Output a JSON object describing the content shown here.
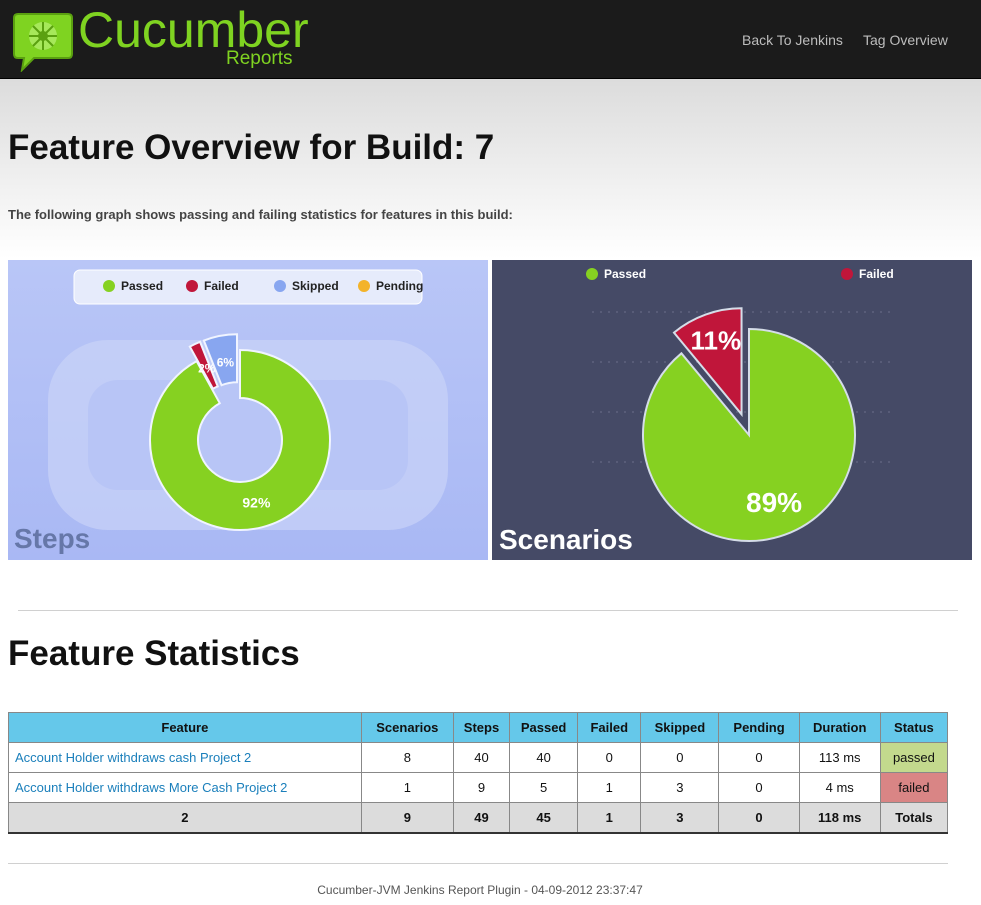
{
  "header": {
    "logo_title": "Cucumber",
    "logo_subtitle": "Reports",
    "nav": {
      "back_to_jenkins": "Back To Jenkins",
      "tag_overview": "Tag Overview"
    },
    "brand_color": "#7fd321"
  },
  "page": {
    "title": "Feature Overview for Build: 7",
    "intro": "The following graph shows passing and failing statistics for features in this build:",
    "stats_title": "Feature Statistics",
    "footer": "Cucumber-JVM Jenkins Report Plugin - 04-09-2012 23:37:47"
  },
  "chart_data": [
    {
      "type": "pie",
      "title": "Steps",
      "legend": [
        "Passed",
        "Failed",
        "Skipped",
        "Pending"
      ],
      "legend_placement": "top",
      "slices": [
        {
          "name": "Passed",
          "value": 92,
          "label": "92%",
          "color": "#86d121"
        },
        {
          "name": "Failed",
          "value": 2,
          "label": "2%",
          "color": "#c0163a"
        },
        {
          "name": "Skipped",
          "value": 6,
          "label": "6%",
          "color": "#88a6f0"
        },
        {
          "name": "Pending",
          "value": 0,
          "label": "",
          "color": "#f3b32a"
        }
      ]
    },
    {
      "type": "pie",
      "title": "Scenarios",
      "legend": [
        "Passed",
        "Failed"
      ],
      "legend_placement": "top",
      "slices": [
        {
          "name": "Passed",
          "value": 89,
          "label": "89%",
          "color": "#86d121"
        },
        {
          "name": "Failed",
          "value": 11,
          "label": "11%",
          "color": "#c0163a"
        }
      ]
    }
  ],
  "table": {
    "headers": [
      "Feature",
      "Scenarios",
      "Steps",
      "Passed",
      "Failed",
      "Skipped",
      "Pending",
      "Duration",
      "Status"
    ],
    "rows": [
      {
        "feature": "Account Holder withdraws cash Project 2",
        "scenarios": "8",
        "steps": "40",
        "passed": "40",
        "failed": "0",
        "skipped": "0",
        "pending": "0",
        "duration": "113 ms",
        "status": "passed"
      },
      {
        "feature": "Account Holder withdraws More Cash Project 2",
        "scenarios": "1",
        "steps": "9",
        "passed": "5",
        "failed": "1",
        "skipped": "3",
        "pending": "0",
        "duration": "4 ms",
        "status": "failed"
      }
    ],
    "totals": {
      "feature": "2",
      "scenarios": "9",
      "steps": "49",
      "passed": "45",
      "failed": "1",
      "skipped": "3",
      "pending": "0",
      "duration": "118 ms",
      "status": "Totals"
    },
    "status_colors": {
      "passed": "#c3d98d",
      "failed": "#d98585"
    },
    "header_color": "#65c8ea"
  }
}
